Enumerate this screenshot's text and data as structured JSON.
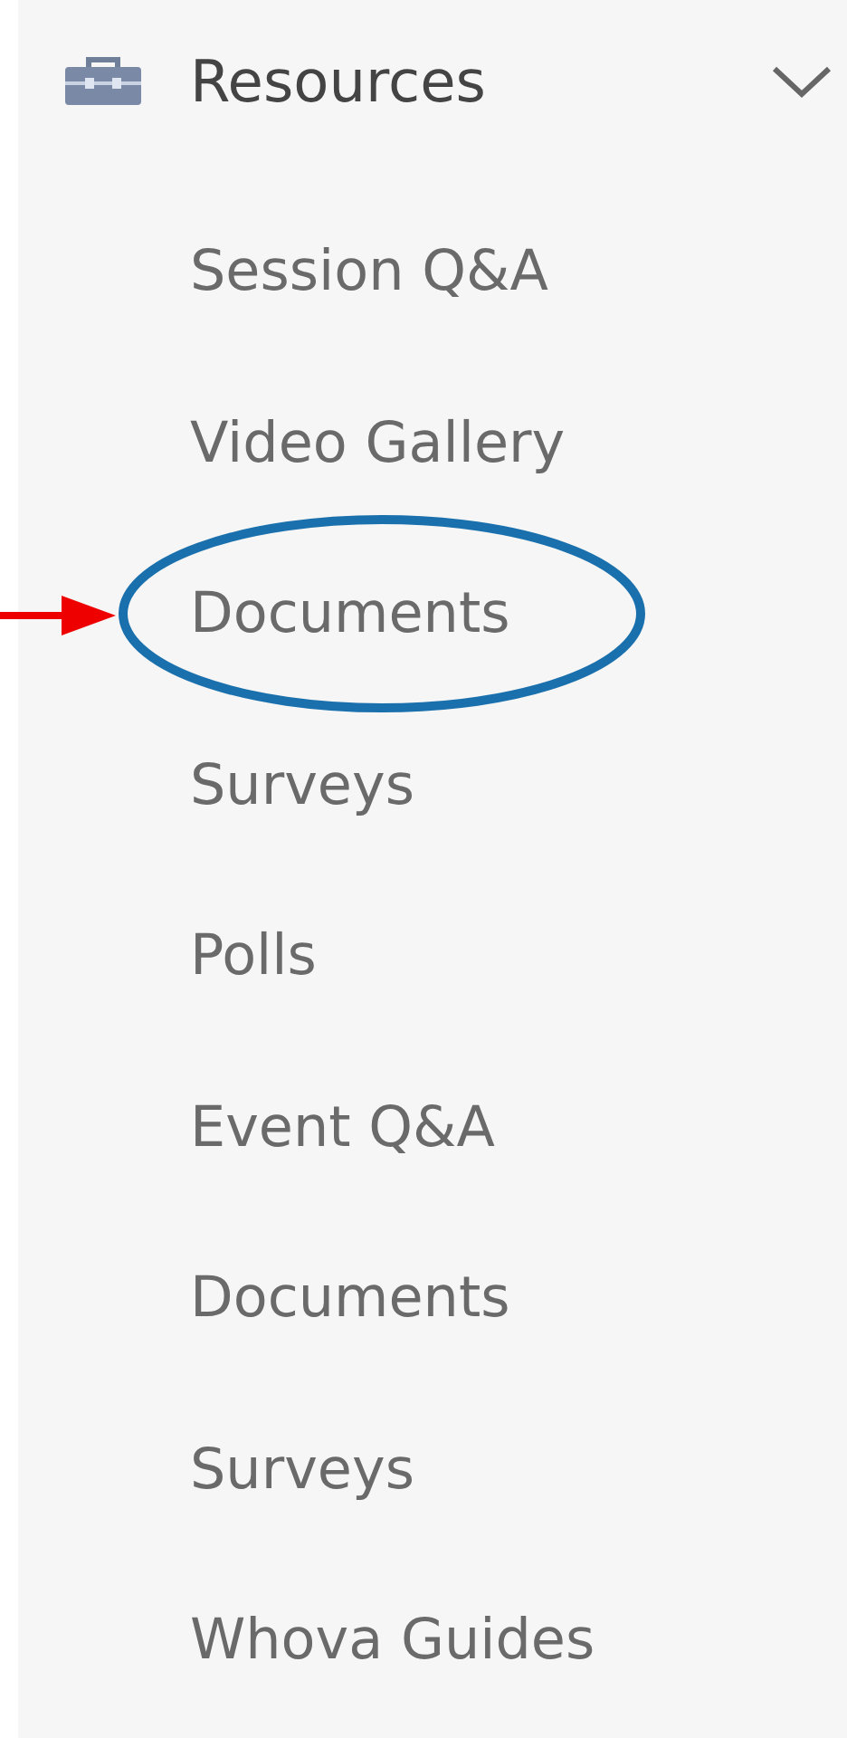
{
  "menu": {
    "label": "Resources",
    "expanded": true,
    "items": [
      {
        "label": "Session Q&A",
        "highlighted": false
      },
      {
        "label": "Video Gallery",
        "highlighted": false
      },
      {
        "label": "Documents",
        "highlighted": true
      },
      {
        "label": "Surveys",
        "highlighted": false
      },
      {
        "label": "Polls",
        "highlighted": false
      },
      {
        "label": "Event Q&A",
        "highlighted": false
      },
      {
        "label": "Documents",
        "highlighted": false
      },
      {
        "label": "Surveys",
        "highlighted": false
      },
      {
        "label": "Whova Guides",
        "highlighted": false
      }
    ]
  }
}
